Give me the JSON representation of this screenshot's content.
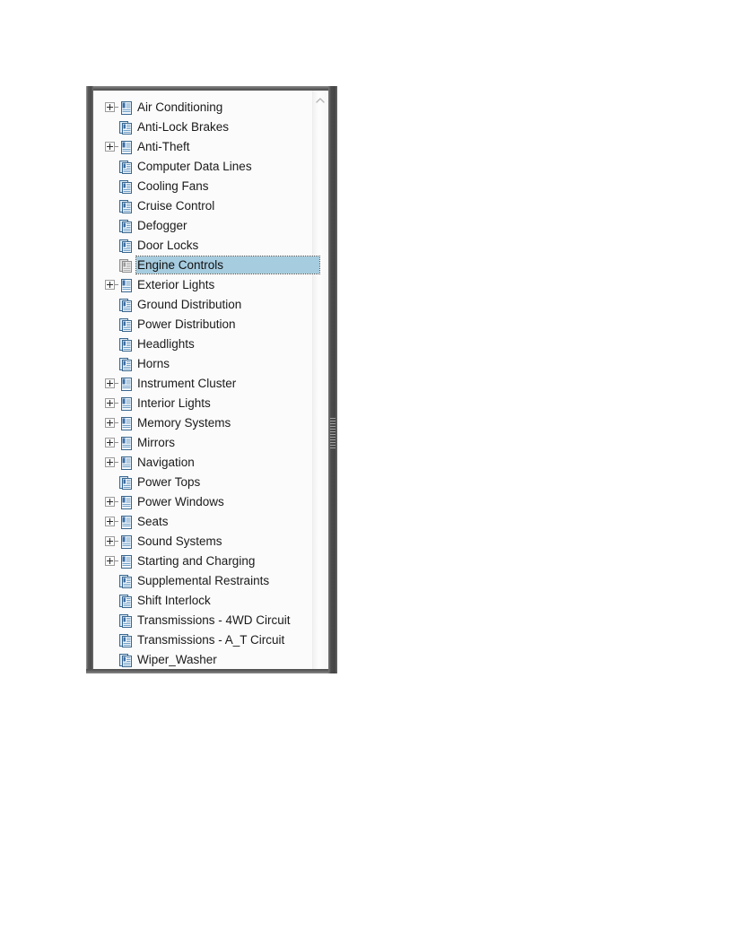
{
  "panel": {
    "name": "wiring-diagram-system-tree",
    "scroll_up_icon": "chevron-up-icon",
    "scrollbar_grip": "scrollbar-grip"
  },
  "tree": {
    "selected_item": "Engine Controls",
    "items": [
      {
        "label": "Air Conditioning",
        "expandable": true,
        "icon": "document-icon",
        "selected": false
      },
      {
        "label": "Anti-Lock Brakes",
        "expandable": false,
        "icon": "document-stack-icon",
        "selected": false
      },
      {
        "label": "Anti-Theft",
        "expandable": true,
        "icon": "document-icon",
        "selected": false
      },
      {
        "label": "Computer Data Lines",
        "expandable": false,
        "icon": "document-stack-icon",
        "selected": false
      },
      {
        "label": "Cooling Fans",
        "expandable": false,
        "icon": "document-stack-icon",
        "selected": false
      },
      {
        "label": "Cruise Control",
        "expandable": false,
        "icon": "document-stack-icon",
        "selected": false
      },
      {
        "label": "Defogger",
        "expandable": false,
        "icon": "document-stack-icon",
        "selected": false
      },
      {
        "label": "Door Locks",
        "expandable": false,
        "icon": "document-stack-icon",
        "selected": false
      },
      {
        "label": "Engine Controls",
        "expandable": false,
        "icon": "document-stack-icon",
        "selected": true
      },
      {
        "label": "Exterior Lights",
        "expandable": true,
        "icon": "document-icon",
        "selected": false
      },
      {
        "label": "Ground Distribution",
        "expandable": false,
        "icon": "document-stack-icon",
        "selected": false
      },
      {
        "label": "Power Distribution",
        "expandable": false,
        "icon": "document-stack-icon",
        "selected": false
      },
      {
        "label": "Headlights",
        "expandable": false,
        "icon": "document-stack-icon",
        "selected": false
      },
      {
        "label": "Horns",
        "expandable": false,
        "icon": "document-stack-icon",
        "selected": false
      },
      {
        "label": "Instrument Cluster",
        "expandable": true,
        "icon": "document-icon",
        "selected": false
      },
      {
        "label": "Interior Lights",
        "expandable": true,
        "icon": "document-icon",
        "selected": false
      },
      {
        "label": "Memory Systems",
        "expandable": true,
        "icon": "document-icon",
        "selected": false
      },
      {
        "label": "Mirrors",
        "expandable": true,
        "icon": "document-icon",
        "selected": false
      },
      {
        "label": "Navigation",
        "expandable": true,
        "icon": "document-icon",
        "selected": false
      },
      {
        "label": "Power Tops",
        "expandable": false,
        "icon": "document-stack-icon",
        "selected": false
      },
      {
        "label": "Power Windows",
        "expandable": true,
        "icon": "document-icon",
        "selected": false
      },
      {
        "label": "Seats",
        "expandable": true,
        "icon": "document-icon",
        "selected": false
      },
      {
        "label": "Sound Systems",
        "expandable": true,
        "icon": "document-icon",
        "selected": false
      },
      {
        "label": "Starting and Charging",
        "expandable": true,
        "icon": "document-icon",
        "selected": false
      },
      {
        "label": "Supplemental Restraints",
        "expandable": false,
        "icon": "document-stack-icon",
        "selected": false
      },
      {
        "label": "Shift Interlock",
        "expandable": false,
        "icon": "document-stack-icon",
        "selected": false
      },
      {
        "label": "Transmissions - 4WD Circuit",
        "expandable": false,
        "icon": "document-stack-icon",
        "selected": false
      },
      {
        "label": "Transmissions - A_T Circuit",
        "expandable": false,
        "icon": "document-stack-icon",
        "selected": false
      },
      {
        "label": "Wiper_Washer",
        "expandable": false,
        "icon": "document-stack-icon",
        "selected": false
      }
    ]
  },
  "colors": {
    "selection": "#a6ccdf",
    "frame": "#4f4f4f",
    "content_bg": "#fbfbfb",
    "icon_blue": "#3c6ea5",
    "text": "#1a1a1a"
  }
}
